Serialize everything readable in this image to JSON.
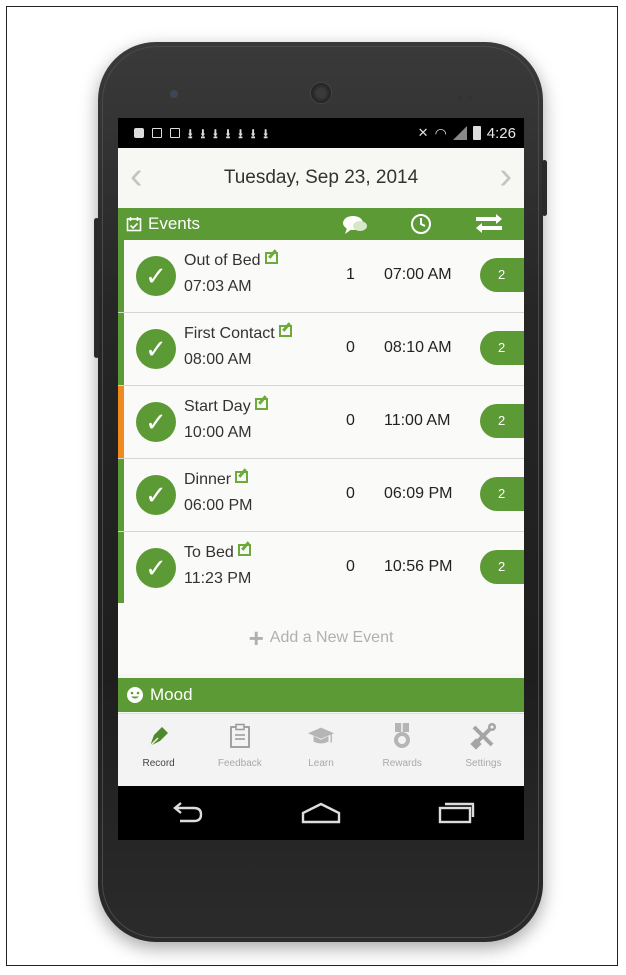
{
  "status_bar": {
    "time": "4:26"
  },
  "header": {
    "date": "Tuesday, Sep 23, 2014",
    "prev_label": "‹",
    "next_label": "›"
  },
  "events_section": {
    "label": "Events",
    "label_icon": "calendar-check-icon",
    "column_icons": [
      "comment-icon",
      "clock-icon",
      "swap-icon"
    ]
  },
  "events": [
    {
      "name": "Out of Bed",
      "time": "07:03 AM",
      "count": "1",
      "scheduled": "07:00 AM",
      "badge": "2",
      "accent": "#5c9a35"
    },
    {
      "name": "First Contact",
      "time": "08:00 AM",
      "count": "0",
      "scheduled": "08:10 AM",
      "badge": "2",
      "accent": "#5c9a35"
    },
    {
      "name": "Start Day",
      "time": "10:00 AM",
      "count": "0",
      "scheduled": "11:00 AM",
      "badge": "2",
      "accent": "#f08a1c"
    },
    {
      "name": "Dinner",
      "time": "06:00 PM",
      "count": "0",
      "scheduled": "06:09 PM",
      "badge": "2",
      "accent": "#5c9a35"
    },
    {
      "name": "To Bed",
      "time": "11:23 PM",
      "count": "0",
      "scheduled": "10:56 PM",
      "badge": "2",
      "accent": "#5c9a35"
    }
  ],
  "add_event": {
    "label": "Add a New Event"
  },
  "mood_section": {
    "label": "Mood",
    "label_icon": "smiley-icon"
  },
  "tabs": [
    {
      "label": "Record",
      "icon": "pen-icon",
      "active": true
    },
    {
      "label": "Feedback",
      "icon": "clipboard-icon",
      "active": false
    },
    {
      "label": "Learn",
      "icon": "graduation-cap-icon",
      "active": false
    },
    {
      "label": "Rewards",
      "icon": "medal-icon",
      "active": false
    },
    {
      "label": "Settings",
      "icon": "tools-icon",
      "active": false
    }
  ],
  "colors": {
    "accent_green": "#5c9a35",
    "accent_orange": "#f08a1c"
  }
}
